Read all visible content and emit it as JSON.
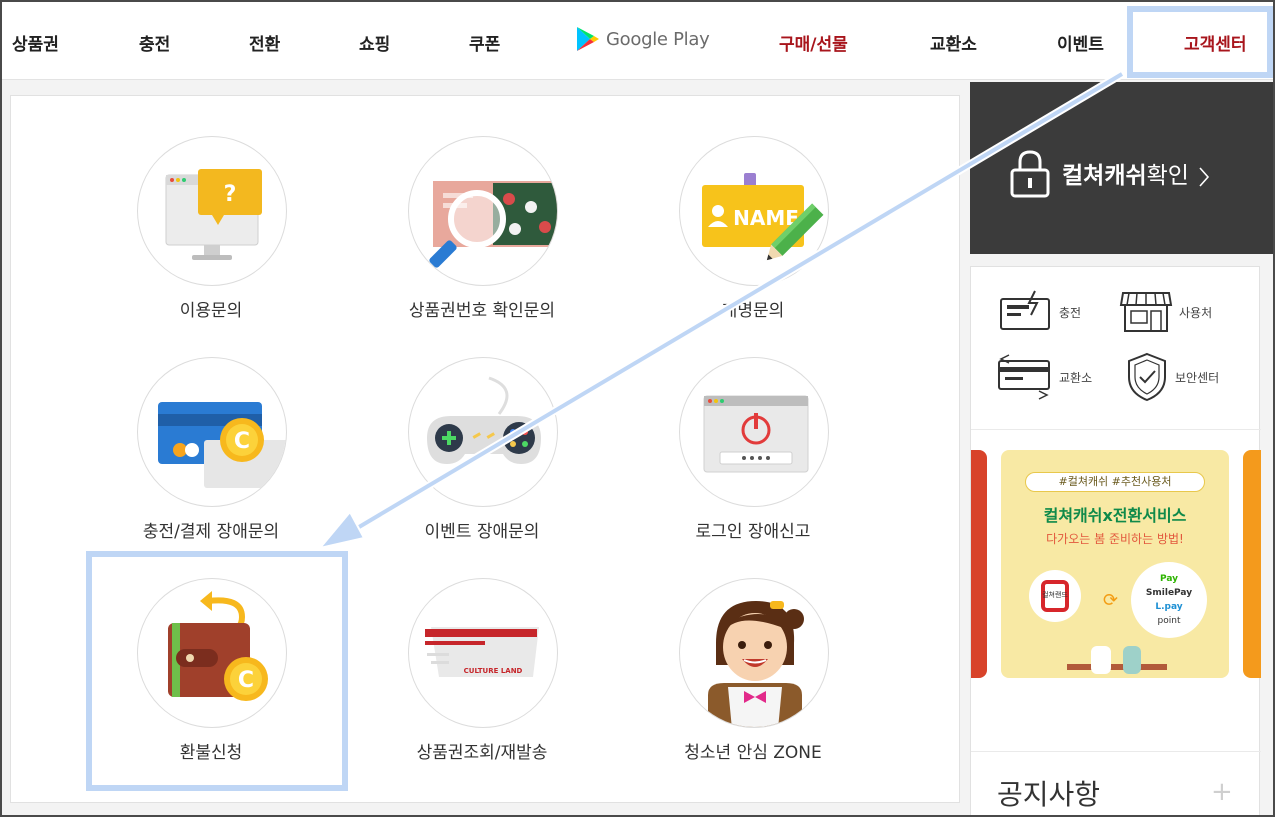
{
  "nav": {
    "items": [
      "상품권",
      "충전",
      "전환",
      "쇼핑",
      "쿠폰"
    ],
    "google_play": "Google Play",
    "purchase_gift": "구매/선물",
    "exchange": "교환소",
    "event": "이벤트",
    "customer_center": "고객센터"
  },
  "menu": {
    "tiles": [
      {
        "label": "이용문의",
        "icon": "monitor-question-icon"
      },
      {
        "label": "상품권번호 확인문의",
        "icon": "voucher-magnifier-icon"
      },
      {
        "label": "개명문의",
        "icon": "name-tag-pencil-icon"
      },
      {
        "label": "충전/결제 장애문의",
        "icon": "card-coin-icon"
      },
      {
        "label": "이벤트 장애문의",
        "icon": "gamepad-icon"
      },
      {
        "label": "로그인 장애신고",
        "icon": "browser-power-icon"
      },
      {
        "label": "환불신청",
        "icon": "wallet-refund-icon"
      },
      {
        "label": "상품권조회/재발송",
        "icon": "culture-land-card-icon"
      },
      {
        "label": "청소년 안심 ZONE",
        "icon": "girl-character-icon"
      }
    ],
    "card_brand": "CULTURE LAND",
    "name_tag": "NAME"
  },
  "sidebar": {
    "cash_check_bold": "컬쳐캐쉬",
    "cash_check_rest": "확인",
    "quick_links": [
      "충전",
      "사용처",
      "교환소",
      "보안센터"
    ],
    "banner": {
      "tag": "#컬쳐캐쉬 #추천사용처",
      "title": "컬쳐캐쉬x전환서비스",
      "subtitle": "다가오는 봄 준비하는 방법!",
      "coin_label": "컬쳐랜드",
      "brands": [
        "Pay",
        "SmilePay",
        "L.pay",
        "point"
      ]
    },
    "notice_title": "공지사항",
    "notice_more": "+"
  },
  "colors": {
    "accent_red": "#a8151c",
    "highlight_blue": "#bfd6f5",
    "dark_panel": "#3b3b3b"
  }
}
